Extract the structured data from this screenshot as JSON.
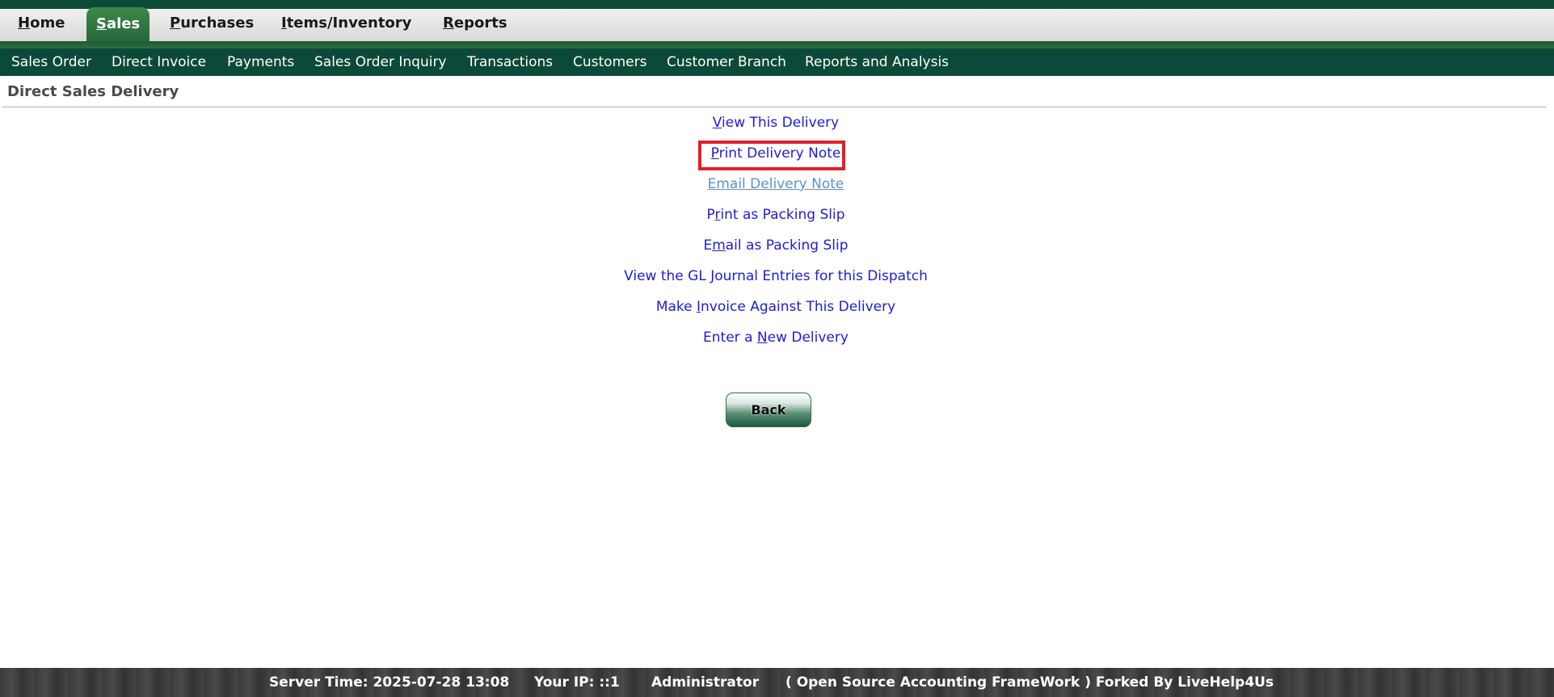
{
  "tabs": {
    "home": {
      "key": "H",
      "rest": "ome"
    },
    "sales": {
      "key": "S",
      "rest": "ales"
    },
    "purchases": {
      "key": "P",
      "rest": "urchases"
    },
    "items": {
      "key": "I",
      "rest": "tems/Inventory"
    },
    "reports": {
      "key": "R",
      "rest": "eports"
    }
  },
  "subnav": {
    "sales_order": "Sales Order",
    "direct_invoice": "Direct Invoice",
    "payments": "Payments",
    "sales_order_inquiry": "Sales Order Inquiry",
    "transactions": "Transactions",
    "customers": "Customers",
    "customer_branch": "Customer Branch",
    "reports_analysis": "Reports and Analysis"
  },
  "page": {
    "title": "Direct Sales Delivery"
  },
  "actions": {
    "view_delivery": {
      "pre": "",
      "key": "V",
      "post": "iew This Delivery"
    },
    "print_delivery_note": {
      "pre": "",
      "key": "P",
      "post": "rint Delivery Note"
    },
    "email_delivery_note": {
      "label": "Email Delivery Note"
    },
    "print_packing_slip": {
      "pre": "P",
      "key": "r",
      "post": "int as Packing Slip"
    },
    "email_packing_slip": {
      "pre": "E",
      "key": "m",
      "post": "ail as Packing Slip"
    },
    "view_gl": {
      "label": "View the GL Journal Entries for this Dispatch"
    },
    "make_invoice": {
      "pre": "Make ",
      "key": "I",
      "post": "nvoice Against This Delivery"
    },
    "new_delivery": {
      "pre": "Enter a ",
      "key": "N",
      "post": "ew Delivery"
    }
  },
  "back_button": {
    "label": "Back"
  },
  "footer": {
    "server_time": "Server Time: 2025-07-28 13:08",
    "ip": "Your IP: ::1",
    "user": "Administrator",
    "credit": "( Open Source Accounting FrameWork ) Forked By LiveHelp4Us"
  },
  "colors": {
    "brand_green": "#0b4a38",
    "link_blue": "#1d1dd8",
    "highlight_red": "#e0202b"
  }
}
